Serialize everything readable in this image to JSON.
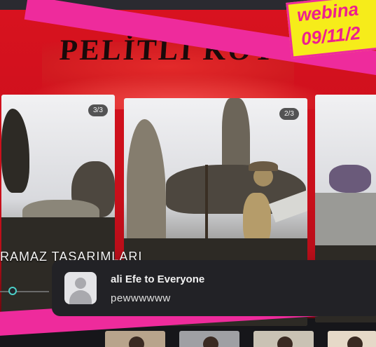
{
  "slide": {
    "title": "PELİTLİ KÖY",
    "caption": "RAMAZ TASARIMLARI",
    "cards": [
      {
        "badge": "3/3"
      },
      {
        "badge": "2/3"
      }
    ]
  },
  "sticker": {
    "line1": "webina",
    "line2": "09/11/2"
  },
  "chat_toast": {
    "from": "ali Efe to Everyone",
    "message": "pewwwwww"
  },
  "colors": {
    "slide_red": "#d8121f",
    "brand_pink": "#ee2b9c",
    "sticker_yellow": "#f6ec1a",
    "toast_bg": "#222226",
    "slider_accent": "#4bd0c8"
  }
}
